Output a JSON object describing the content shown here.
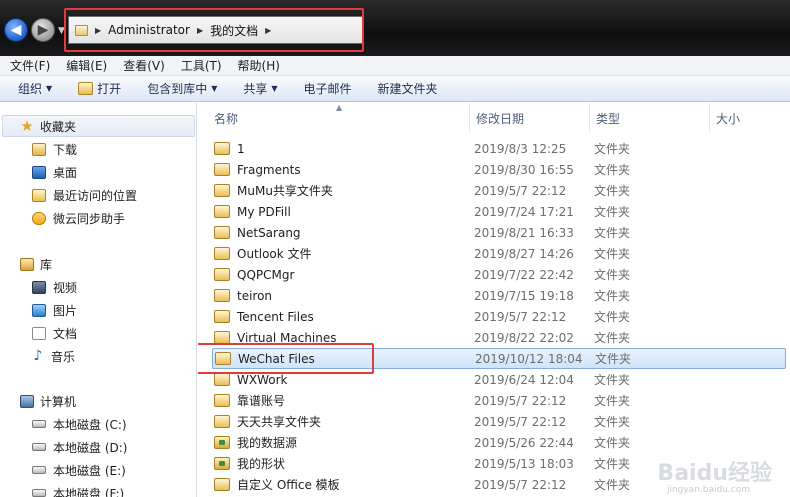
{
  "address": {
    "segments": [
      "Administrator",
      "我的文档"
    ]
  },
  "menu": [
    "文件(F)",
    "编辑(E)",
    "查看(V)",
    "工具(T)",
    "帮助(H)"
  ],
  "commands": {
    "organize": "组织",
    "open": "打开",
    "include_library": "包含到库中",
    "share": "共享",
    "email": "电子邮件",
    "new_folder": "新建文件夹"
  },
  "nav": {
    "favorites": "收藏夹",
    "favorites_items": [
      "下载",
      "桌面",
      "最近访问的位置",
      "微云同步助手"
    ],
    "libraries": "库",
    "libraries_items": [
      "视频",
      "图片",
      "文档",
      "音乐"
    ],
    "computer": "计算机",
    "computer_items": [
      "本地磁盘 (C:)",
      "本地磁盘 (D:)",
      "本地磁盘 (E:)",
      "本地磁盘 (F:)"
    ]
  },
  "columns": {
    "name": "名称",
    "modified": "修改日期",
    "type": "类型",
    "size": "大小"
  },
  "files": [
    {
      "name": "1",
      "modified": "2019/8/3 12:25",
      "type": "文件夹"
    },
    {
      "name": "Fragments",
      "modified": "2019/8/30 16:55",
      "type": "文件夹"
    },
    {
      "name": "MuMu共享文件夹",
      "modified": "2019/5/7 22:12",
      "type": "文件夹"
    },
    {
      "name": "My PDFill",
      "modified": "2019/7/24 17:21",
      "type": "文件夹"
    },
    {
      "name": "NetSarang",
      "modified": "2019/8/21 16:33",
      "type": "文件夹"
    },
    {
      "name": "Outlook 文件",
      "modified": "2019/8/27 14:26",
      "type": "文件夹"
    },
    {
      "name": "QQPCMgr",
      "modified": "2019/7/22 22:42",
      "type": "文件夹"
    },
    {
      "name": "teiron",
      "modified": "2019/7/15 19:18",
      "type": "文件夹"
    },
    {
      "name": "Tencent Files",
      "modified": "2019/5/7 22:12",
      "type": "文件夹"
    },
    {
      "name": "Virtual Machines",
      "modified": "2019/8/22 22:02",
      "type": "文件夹"
    },
    {
      "name": "WeChat Files",
      "modified": "2019/10/12 18:04",
      "type": "文件夹"
    },
    {
      "name": "WXWork",
      "modified": "2019/6/24 12:04",
      "type": "文件夹"
    },
    {
      "name": "靠谱账号",
      "modified": "2019/5/7 22:12",
      "type": "文件夹"
    },
    {
      "name": "天天共享文件夹",
      "modified": "2019/5/7 22:12",
      "type": "文件夹"
    },
    {
      "name": "我的数据源",
      "modified": "2019/5/26 22:44",
      "type": "文件夹"
    },
    {
      "name": "我的形状",
      "modified": "2019/5/13 18:03",
      "type": "文件夹"
    },
    {
      "name": "自定义 Office 模板",
      "modified": "2019/5/7 22:12",
      "type": "文件夹"
    }
  ],
  "watermark": "Baidu经验",
  "watermark_sub": "jingyan.baidu.com"
}
